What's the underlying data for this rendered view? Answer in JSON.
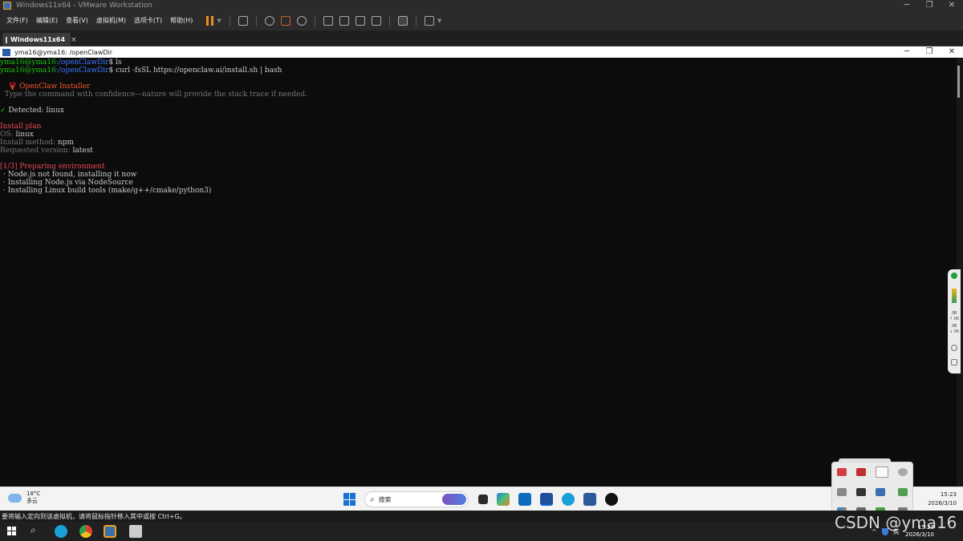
{
  "vmware": {
    "window_title": "Windows11x64 - VMware Workstation",
    "menus": [
      "文件(F)",
      "编辑(E)",
      "查看(V)",
      "虚拟机(M)",
      "选项卡(T)",
      "帮助(H)"
    ],
    "tab_label": "Windows11x64",
    "tab_close": "×",
    "status_message": "要将输入定向到该虚拟机，请将鼠标指针移入其中或按 Ctrl+G。",
    "accent_color": "#e89020"
  },
  "window_buttons": {
    "minimize": "─",
    "maximize": "❐",
    "close": "✕"
  },
  "terminal": {
    "window_title": "yma16@yma16: /openClawDir",
    "user_host": "yma16@yma16",
    "path": ":/openClawDir",
    "prompt_suffix": "$ ",
    "cmd1": "ls",
    "cmd2": "curl -fsSL https://openclaw.ai/install.sh | bash",
    "installer_title": "🦞 OpenClaw Installer",
    "installer_tagline": "  Type the command with confidence—nature will provide the stack trace if needed.",
    "detected_check": "✓",
    "detected_text": " Detected: linux",
    "plan_heading": "Install plan",
    "os_label": "OS:",
    "os_value": " linux",
    "method_label": "Install method:",
    "method_value": " npm",
    "version_label": "Requested version:",
    "version_value": " latest",
    "step_heading": "[1/3] Preparing environment",
    "step_lines": [
      "· Node.js not found, installing it now",
      "· Installing Node.js via NodeSource",
      "· Installing Linux build tools (make/g++/cmake/python3)"
    ],
    "colors": {
      "prompt_user": "#16c60c",
      "prompt_path": "#3b78ff",
      "heading": "#e74856",
      "dim": "#767676"
    }
  },
  "side_strip": {
    "line1": "0B",
    "line2": "↑ 0K",
    "line3": "0B",
    "line4": "↓ 0K"
  },
  "guest_taskbar": {
    "weather_temp": "18°C",
    "weather_desc": "多云",
    "search_placeholder": "搜索",
    "time": "15:23",
    "date": "2026/3/10"
  },
  "host_taskbar": {
    "ime": "英",
    "time": "15:23",
    "date": "2026/3/10"
  },
  "watermark": "CSDN @yma16"
}
